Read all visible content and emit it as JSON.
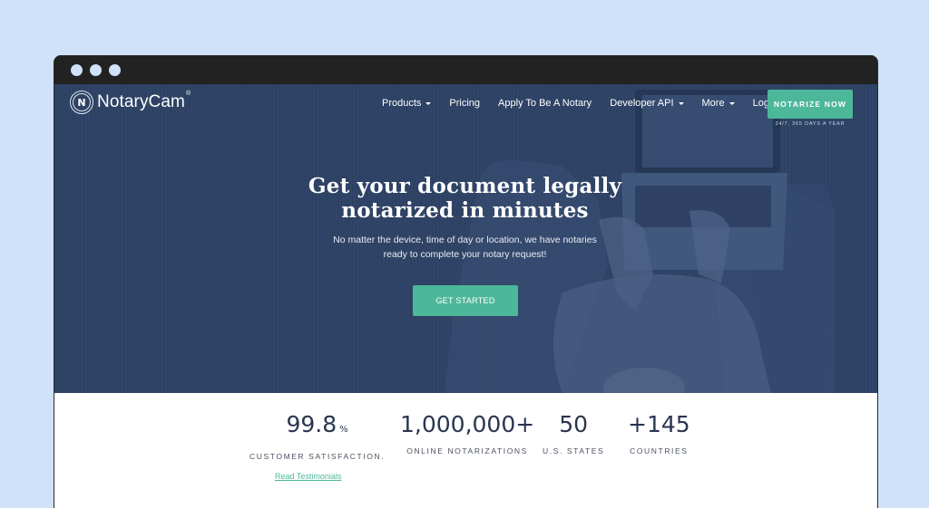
{
  "window": {
    "controls": [
      "close",
      "minimize",
      "maximize"
    ]
  },
  "brand": {
    "logo_mark": "N",
    "name": "NotaryCam",
    "registered": "®"
  },
  "nav": {
    "items": [
      {
        "label": "Products",
        "dropdown": true
      },
      {
        "label": "Pricing",
        "dropdown": false
      },
      {
        "label": "Apply To Be A Notary",
        "dropdown": false
      },
      {
        "label": "Developer API",
        "dropdown": true
      },
      {
        "label": "More",
        "dropdown": true
      },
      {
        "label": "Login",
        "dropdown": false
      }
    ],
    "cta_label": "NOTARIZE NOW",
    "cta_sub": "24/7, 365 DAYS A YEAR"
  },
  "hero": {
    "headline_line1": "Get your document legally",
    "headline_line2": "notarized in minutes",
    "subtext_line1": "No matter the device, time of day or location, we have notaries",
    "subtext_line2": "ready to complete your notary request!",
    "cta_label": "GET STARTED"
  },
  "stats": [
    {
      "value": "99.8",
      "unit": "%",
      "label": "CUSTOMER SATISFACTION."
    },
    {
      "value": "1,000,000+",
      "unit": "",
      "label": "ONLINE NOTARIZATIONS"
    },
    {
      "value": "50",
      "unit": "",
      "label": "U.S. STATES"
    },
    {
      "value": "+145",
      "unit": "",
      "label": "COUNTRIES"
    }
  ],
  "testimonials_link": "Read Testimonials",
  "colors": {
    "accent": "#4db79a",
    "hero_overlay": "#2f4466",
    "page_background": "#cfe2fa",
    "window_chrome": "#222222",
    "stat_text": "#2a3550"
  }
}
